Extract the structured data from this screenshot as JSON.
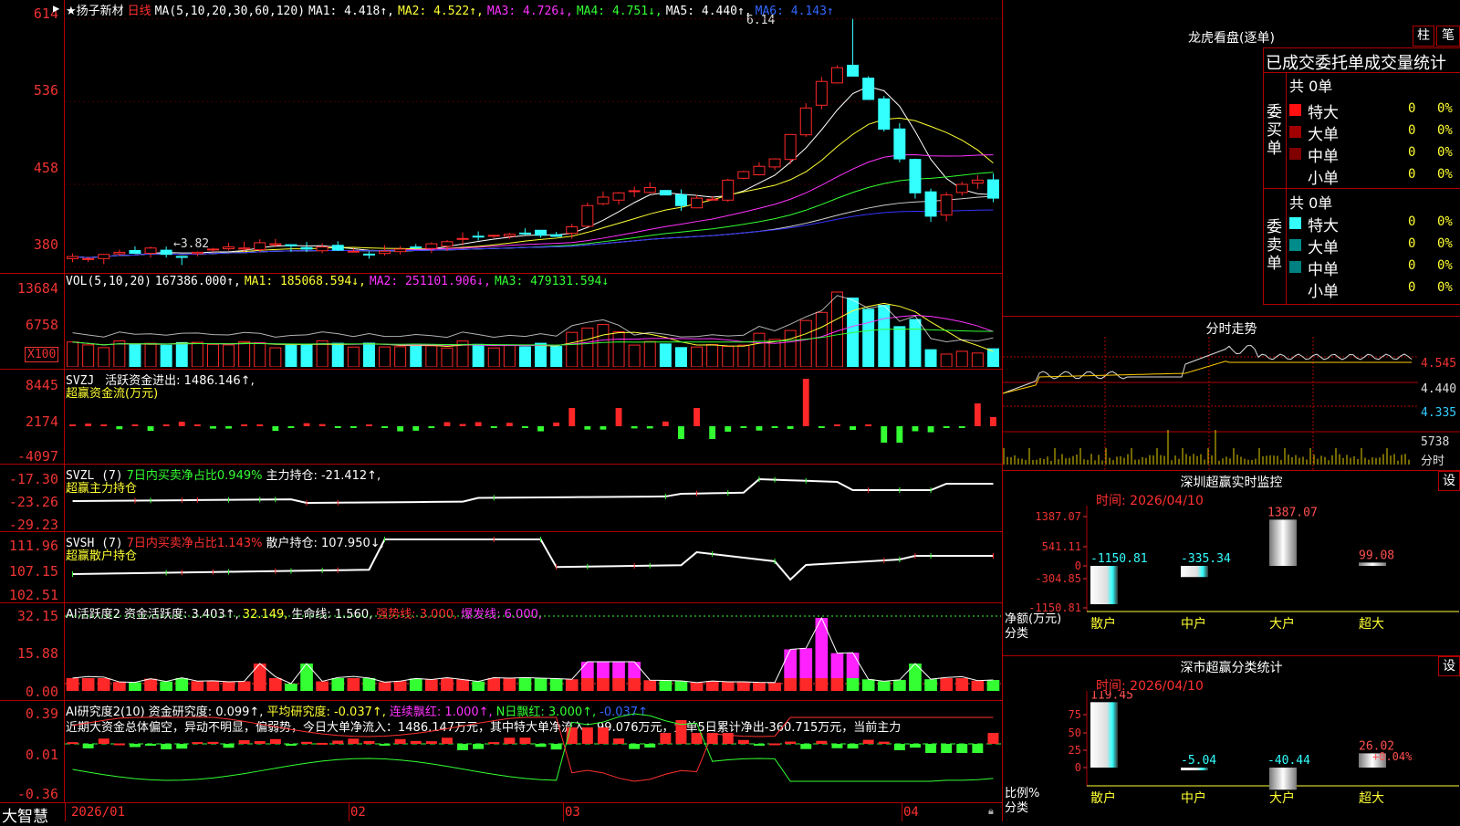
{
  "stock": {
    "name": "★扬子新材",
    "period": "日线",
    "app_logo": "大智慧"
  },
  "colors": {
    "up": "#ff2828",
    "down": "#33ffff",
    "ma1": "#ffffff",
    "ma2": "#ffff33",
    "ma3": "#ff33ff",
    "ma4": "#33ff33",
    "ma5": "#cfcfcf",
    "ma6": "#3333ff",
    "grid": "#b00000"
  },
  "kline": {
    "ma_label": "MA(5,10,20,30,60,120)",
    "ma1": "MA1: 4.418↑,",
    "ma2": "MA2: 4.522↑,",
    "ma3": "MA3: 4.726↓,",
    "ma4": "MA4: 4.751↓,",
    "ma5": "MA5: 4.440↑,",
    "ma6": "MA6: 4.143↑",
    "yticks": [
      "614",
      "536",
      "458",
      "380"
    ],
    "high_label": "6.14",
    "low_label": "←3.82"
  },
  "vol": {
    "label": "VOL(5,10,20)",
    "value": "167386.000↑,",
    "ma1": "MA1: 185068.594↓,",
    "ma2": "MA2: 251101.906↓,",
    "ma3": "MA3: 479131.594↓",
    "yticks": [
      "13684",
      "6758"
    ],
    "unit": "X100"
  },
  "svzj": {
    "label": "SVZJ",
    "line": "活跃资金进出: 1486.146↑,",
    "sub": "超赢资金流(万元)",
    "yticks": [
      "8445",
      "2174",
      "-4097"
    ]
  },
  "svzl": {
    "label": "SVZL (7)",
    "ratio": "7日内买卖净占比0.949%",
    "hold": "主力持仓: -21.412↑,",
    "sub": "超赢主力持仓",
    "yticks": [
      "-17.30",
      "-23.26",
      "-29.23"
    ]
  },
  "svsh": {
    "label": "SVSH (7)",
    "ratio": "7日内买卖净占比1.143%",
    "hold": "散户持仓: 107.950↓,",
    "sub": "超赢散户持仓",
    "yticks": [
      "111.96",
      "107.15",
      "102.51"
    ]
  },
  "ai1": {
    "label": "AI活跃度2",
    "l1": "资金活跃度: 3.403↑,",
    "l2": "32.149,",
    "l3": "生命线: 1.560,",
    "l4": "强势线: 3.000,",
    "l5": "爆发线: 6.000,",
    "yticks": [
      "32.15",
      "15.88",
      "0.00"
    ]
  },
  "ai2": {
    "label": "AI研究度2(10)",
    "l1": "资金研究度: 0.099↑,",
    "l2": "平均研究度: -0.037↑,",
    "l3": "连续飘红: 1.000↑,",
    "l4": "N日飘红: 3.000↑,",
    "l5": "-0.037↑",
    "comment": "近期大资金总体偏空，异动不明显，偏弱势，今日大单净流入：1486.147万元，其中特大单净流入：99.076万元，大单5日累计净出-360.715万元，当前主力",
    "yticks": [
      "0.39",
      "0.01",
      "-0.36"
    ]
  },
  "xaxis": [
    "2026/01",
    "02",
    "03",
    "04"
  ],
  "dragon": {
    "title": "龙虎看盘(逐单)",
    "btn_bar": "柱",
    "btn_pen": "笔",
    "heading": "已成交委托单成交量统计",
    "buy_label": "委买单",
    "sell_label": "委卖单",
    "buy_total": "共 0单",
    "sell_total": "共 0单",
    "buy_rows": [
      {
        "name": "特大",
        "v": "0",
        "p": "0%"
      },
      {
        "name": "大单",
        "v": "0",
        "p": "0%"
      },
      {
        "name": "中单",
        "v": "0",
        "p": "0%"
      },
      {
        "name": "小单",
        "v": "0",
        "p": "0%"
      }
    ],
    "sell_rows": [
      {
        "name": "特大",
        "v": "0",
        "p": "0%"
      },
      {
        "name": "大单",
        "v": "0",
        "p": "0%"
      },
      {
        "name": "中单",
        "v": "0",
        "p": "0%"
      },
      {
        "name": "小单",
        "v": "0",
        "p": "0%"
      }
    ]
  },
  "intraday": {
    "title": "分时走势",
    "p1": "4.545",
    "p2": "4.440",
    "p3": "4.335",
    "vol": "5738",
    "vol_label": "分时"
  },
  "sz_monitor": {
    "title": "深圳超赢实时监控",
    "btn": "设",
    "time": "时间: 2026/04/10",
    "yticks": [
      "1387.07",
      "541.11",
      "0",
      "-304.85",
      "-1150.81"
    ],
    "ylabel": "净额(万元)",
    "xlabel": "分类",
    "categories": [
      "散户",
      "中户",
      "大户",
      "超大"
    ],
    "values": [
      -1150.81,
      -335.34,
      1387.07,
      99.08
    ],
    "value_labels": [
      "-1150.81",
      "-335.34",
      "1387.07",
      "99.08"
    ]
  },
  "sz_class": {
    "title": "深市超赢分类统计",
    "btn": "设",
    "time": "时间: 2026/04/10",
    "yticks": [
      "75",
      "50",
      "25",
      "0"
    ],
    "ylabel": "比例%",
    "xlabel": "分类",
    "categories": [
      "散户",
      "中户",
      "大户",
      "超大"
    ],
    "values": [
      119.45,
      -5.04,
      -40.44,
      26.02
    ],
    "value_labels": [
      "119.45",
      "-5.04",
      "-40.44",
      "26.02"
    ],
    "extra_label": "+0.04%"
  }
}
